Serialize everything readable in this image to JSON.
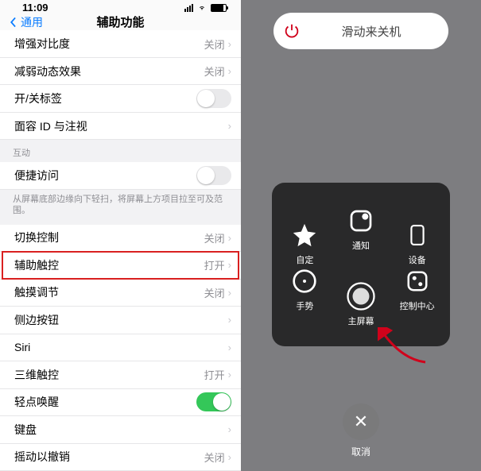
{
  "status": {
    "time": "11:09"
  },
  "nav": {
    "back": "通用",
    "title": "辅助功能"
  },
  "section1": [
    {
      "label": "增强对比度",
      "value": "关闭"
    },
    {
      "label": "减弱动态效果",
      "value": "关闭"
    },
    {
      "label": "开/关标签",
      "toggle": false
    },
    {
      "label": "面容 ID 与注视",
      "value": ""
    }
  ],
  "interSection": {
    "header": "互动"
  },
  "section2": [
    {
      "label": "便捷访问",
      "toggle": false
    }
  ],
  "footnote": "从屏幕底部边缘向下轻扫，将屏幕上方项目拉至可及范围。",
  "section3": [
    {
      "label": "切换控制",
      "value": "关闭"
    },
    {
      "label": "辅助触控",
      "value": "打开",
      "highlight": true
    },
    {
      "label": "触摸调节",
      "value": "关闭"
    },
    {
      "label": "侧边按钮",
      "value": ""
    },
    {
      "label": "Siri",
      "value": ""
    },
    {
      "label": "三维触控",
      "value": "打开"
    },
    {
      "label": "轻点唤醒",
      "toggle": true
    },
    {
      "label": "键盘",
      "value": ""
    },
    {
      "label": "摇动以撤销",
      "value": "关闭"
    }
  ],
  "right": {
    "slider": "滑动来关机",
    "panel": {
      "notify": "通知",
      "custom": "自定",
      "device": "设备",
      "gesture": "手势",
      "home": "主屏幕",
      "control": "控制中心"
    },
    "cancel": "取消"
  }
}
